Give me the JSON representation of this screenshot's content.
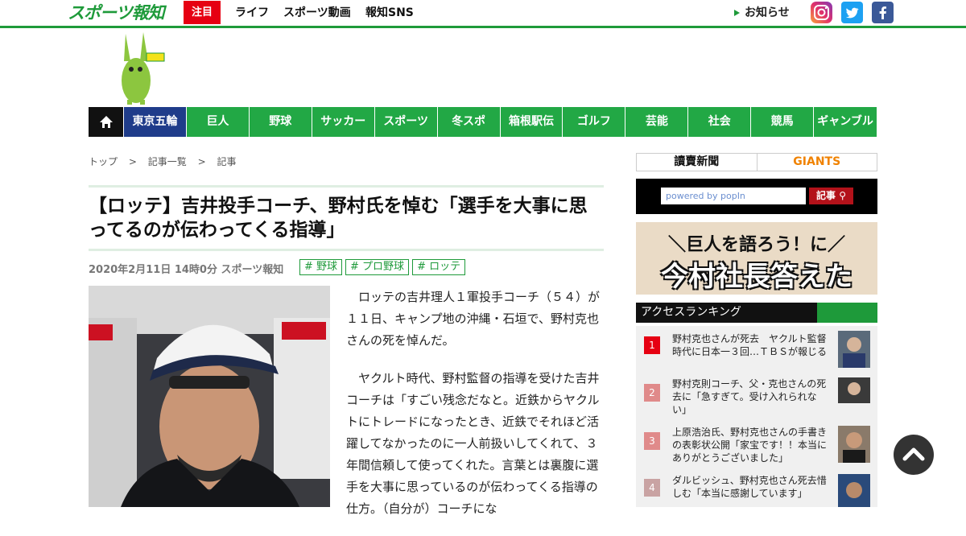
{
  "header": {
    "logo_text": "スポーツ報知",
    "hot_tag": "注目",
    "nav": [
      "ライフ",
      "スポーツ動画",
      "報知SNS"
    ],
    "notice": "お知らせ",
    "social_icons": [
      "instagram-icon",
      "twitter-icon",
      "facebook-icon"
    ]
  },
  "categories": [
    "東京五輪",
    "巨人",
    "野球",
    "サッカー",
    "スポーツ",
    "冬スポ",
    "箱根駅伝",
    "ゴルフ",
    "芸能",
    "社会",
    "競馬",
    "ギャンブル"
  ],
  "breadcrumb": [
    "トップ",
    ">",
    "記事一覧",
    ">",
    "記事"
  ],
  "article": {
    "title": "【ロッテ】吉井投手コーチ、野村氏を悼む「選手を大事に思ってるのが伝わってくる指導」",
    "meta": "2020年2月11日 14時0分  スポーツ報知",
    "tags": [
      "# 野球",
      "# プロ野球",
      "# ロッテ"
    ],
    "paragraphs": [
      "ロッテの吉井理人１軍投手コーチ（５４）が１１日、キャンプ地の沖縄・石垣で、野村克也さんの死を悼んだ。",
      "ヤクルト時代、野村監督の指導を受けた吉井コーチは「すごい残念だなと。近鉄からヤクルトにトレードになったとき、近鉄でそれほど活躍してなかったのに一人前扱いしてくれて、３年間信頼して使ってくれた。言葉とは裏腹に選手を大事に思っているのが伝わってくる指導の仕方。（自分が）コーチにな"
    ]
  },
  "sidebar": {
    "banner_left": "讀賣新聞",
    "banner_right": "GIANTS",
    "search_placeholder": "powered by popIn",
    "search_button": "記事",
    "promo_line1": "＼巨人を語ろう！に／",
    "promo_line2": "今村社長答えた",
    "ranking_title": "アクセスランキング",
    "ranking": [
      {
        "rank": "1",
        "text": "野村克也さんが死去　ヤクルト監督時代に日本一３回…ＴＢＳが報じる",
        "color": "#e60012"
      },
      {
        "rank": "2",
        "text": "野村克則コーチ、父・克也さんの死去に「急すぎて。受け入れられない」",
        "color": "#e08a8a"
      },
      {
        "rank": "3",
        "text": "上原浩治氏、野村克也さんの手書きの表彰状公開「家宝です！！本当にありがとうございました」",
        "color": "#e08a8a"
      },
      {
        "rank": "4",
        "text": "ダルビッシュ、野村克也さん死去惜しむ「本当に感謝しています」",
        "color": "#c9a3a3"
      }
    ]
  }
}
